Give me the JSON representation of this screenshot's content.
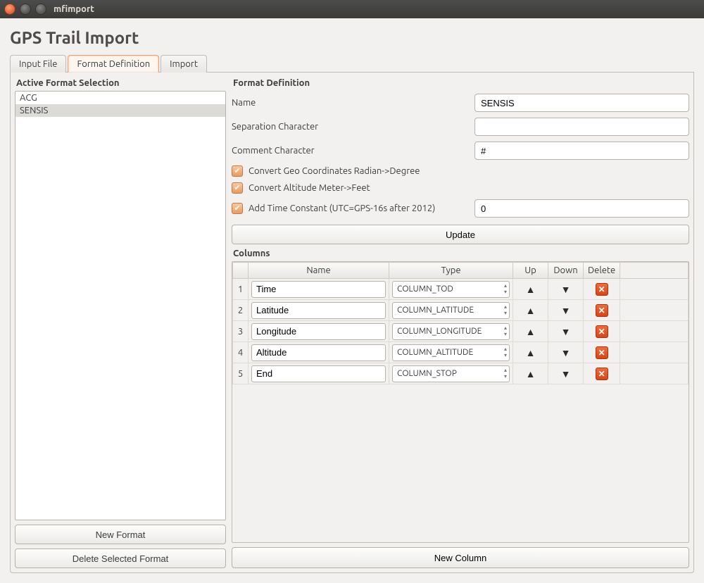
{
  "window": {
    "title": "mfimport"
  },
  "page_title": "GPS Trail Import",
  "tabs": [
    {
      "label": "Input File"
    },
    {
      "label": "Format Definition"
    },
    {
      "label": "Import"
    }
  ],
  "active_tab_index": 1,
  "sidebar": {
    "heading": "Active Format Selection",
    "items": [
      "ACG",
      "SENSIS"
    ],
    "selected_index": 1,
    "new_format_label": "New Format",
    "delete_format_label": "Delete Selected Format"
  },
  "format_def": {
    "heading": "Format Definition",
    "name_label": "Name",
    "name_value": "SENSIS",
    "sep_label": "Separation Character",
    "sep_value": "",
    "comment_label": "Comment Character",
    "comment_value": "#",
    "checks": {
      "geo": {
        "label": "Convert Geo Coordinates Radian->Degree",
        "checked": true
      },
      "alt": {
        "label": "Convert Altitude Meter->Feet",
        "checked": true
      },
      "time": {
        "label": "Add Time Constant (UTC=GPS-16s after 2012)",
        "checked": true,
        "value": "0"
      }
    },
    "update_label": "Update"
  },
  "columns": {
    "heading": "Columns",
    "headers": {
      "name": "Name",
      "type": "Type",
      "up": "Up",
      "down": "Down",
      "delete": "Delete"
    },
    "rows": [
      {
        "idx": "1",
        "name": "Time",
        "type": "COLUMN_TOD"
      },
      {
        "idx": "2",
        "name": "Latitude",
        "type": "COLUMN_LATITUDE"
      },
      {
        "idx": "3",
        "name": "Longitude",
        "type": "COLUMN_LONGITUDE"
      },
      {
        "idx": "4",
        "name": "Altitude",
        "type": "COLUMN_ALTITUDE"
      },
      {
        "idx": "5",
        "name": "End",
        "type": "COLUMN_STOP"
      }
    ],
    "new_column_label": "New Column"
  }
}
